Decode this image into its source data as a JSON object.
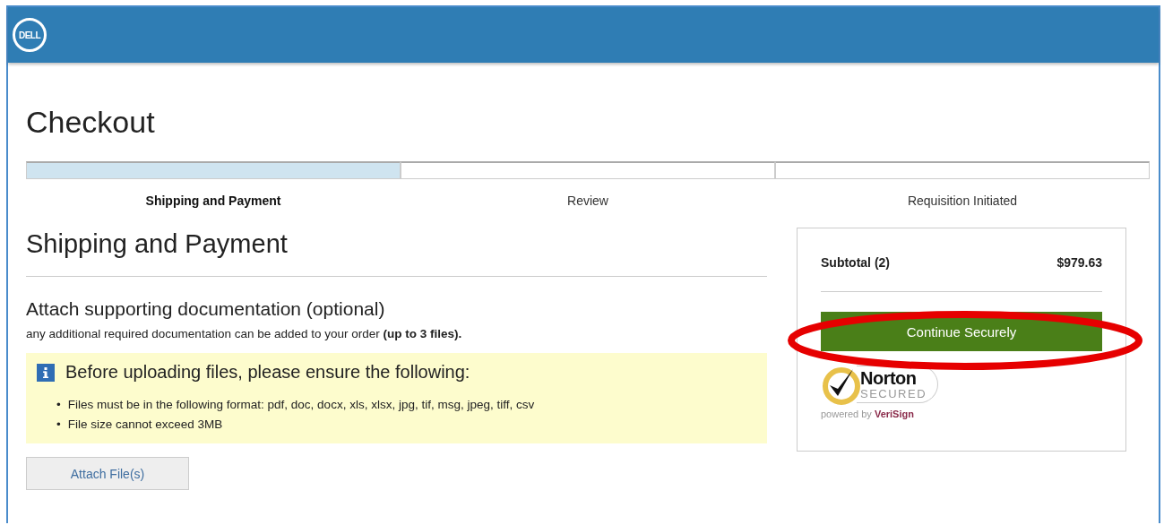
{
  "header": {
    "logo": "DELL"
  },
  "page_title": "Checkout",
  "steps": [
    {
      "label": "Shipping and Payment",
      "selected": true
    },
    {
      "label": "Review",
      "selected": false
    },
    {
      "label": "Requisition Initiated",
      "selected": false
    }
  ],
  "section_title": "Shipping and Payment",
  "attach": {
    "title": "Attach supporting documentation (optional)",
    "description": "any additional required documentation can be added to your order **(up to 3 files).**",
    "notice": {
      "title": "Before uploading files, please ensure the following:",
      "items": [
        {
          "bullet": "•",
          "text": "Files must be in the following format: pdf, doc, docx, xls, xlsx, jpg, tif, msg, jpeg, tiff, csv"
        },
        {
          "bullet": "•",
          "text": "File size cannot exceed 3MB"
        }
      ]
    },
    "button": "Attach File(s)"
  },
  "summary": {
    "label": "Subtotal (2)",
    "amount": "$979.63",
    "button": {
      "label": "Continue Securely",
      "highlighted": true
    },
    "seal": {
      "brand": "Norton",
      "status": "SECURED",
      "powered_prefix": "powered by",
      "powered_brand": "VeriSign"
    }
  }
}
